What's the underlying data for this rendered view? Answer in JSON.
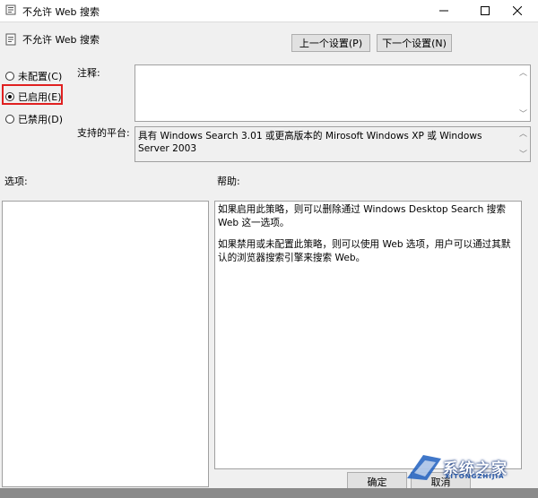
{
  "window": {
    "title": "不允许 Web 搜索",
    "policy_name": "不允许 Web 搜索"
  },
  "nav": {
    "prev_label": "上一个设置(P)",
    "next_label": "下一个设置(N)"
  },
  "state_options": [
    {
      "label": "未配置(C)",
      "selected": false
    },
    {
      "label": "已启用(E)",
      "selected": true
    },
    {
      "label": "已禁用(D)",
      "selected": false
    }
  ],
  "comment": {
    "label": "注释:",
    "value": ""
  },
  "platform": {
    "label": "支持的平台:",
    "value": "具有 Windows Search 3.01 或更高版本的 Mirosoft Windows XP 或 Windows Server 2003"
  },
  "options": {
    "label": "选项:"
  },
  "help": {
    "label": "帮助:",
    "paragraphs": [
      "如果启用此策略，则可以删除通过 Windows Desktop Search 搜索 Web 这一选项。",
      "如果禁用或未配置此策略，则可以使用 Web 选项，用户可以通过其默认的浏览器搜索引擎来搜索 Web。"
    ]
  },
  "footer": {
    "ok_label": "确定",
    "cancel_label": "取消"
  },
  "watermark": {
    "text": "系统之家",
    "sub": "XITONGZHIJIA"
  },
  "colors": {
    "highlight": "#e02020",
    "window_bg": "#f0f0f0"
  }
}
